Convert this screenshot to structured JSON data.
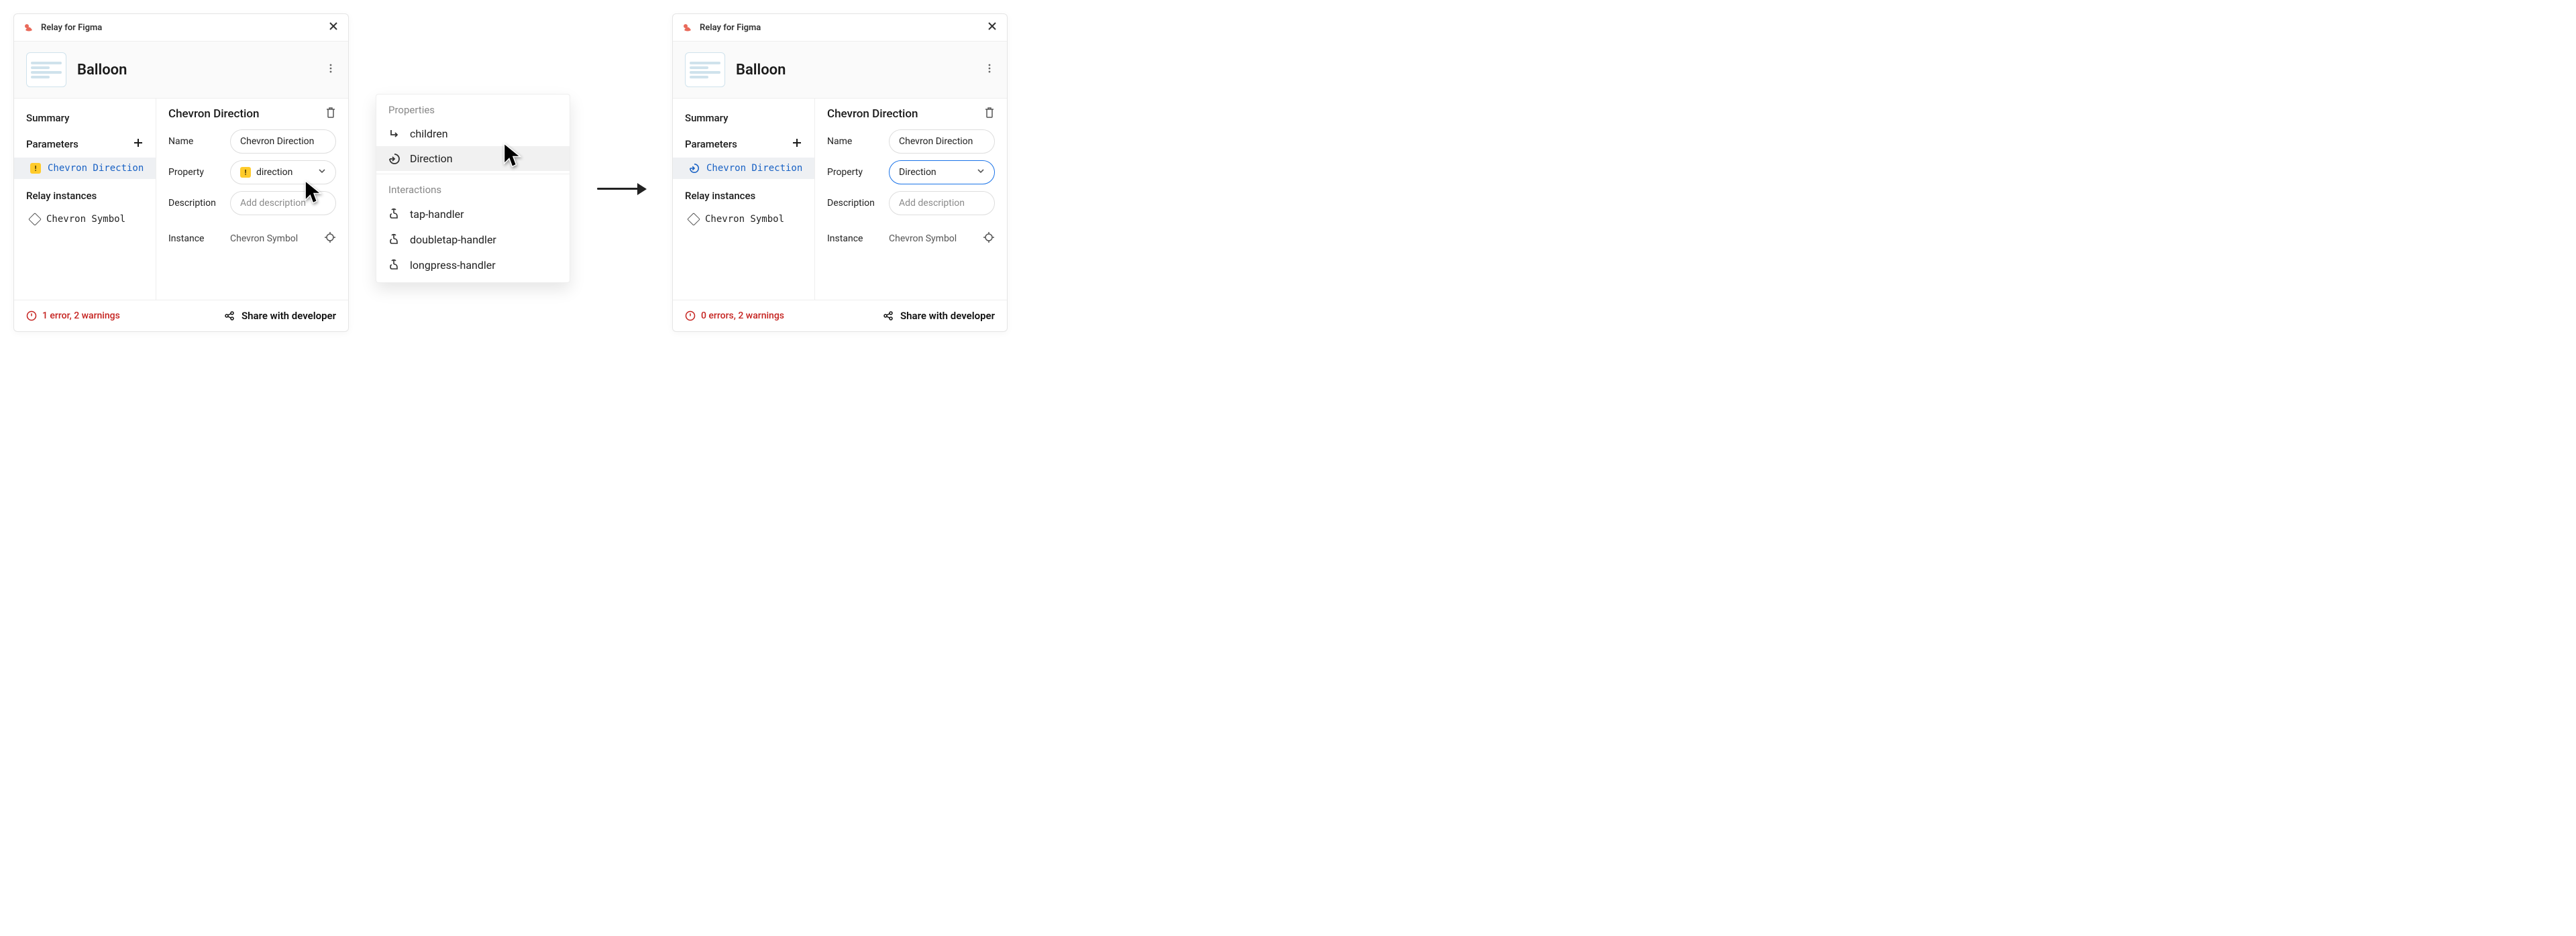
{
  "colors": {
    "accent_blue": "#1861c4",
    "warn_bg": "#ffcb2b",
    "error_red": "#c5221f",
    "brand": "#e96a5b"
  },
  "left": {
    "titlebar": {
      "brand": "Relay for Figma"
    },
    "component_title": "Balloon",
    "sidebar": {
      "summary": "Summary",
      "parameters_label": "Parameters",
      "parameters": [
        {
          "name": "Chevron Direction",
          "warning": true
        }
      ],
      "instances_label": "Relay instances",
      "instances": [
        "Chevron Symbol"
      ]
    },
    "details": {
      "title": "Chevron Direction",
      "rows": {
        "name_label": "Name",
        "name_value": "Chevron Direction",
        "property_label": "Property",
        "property_value": "direction",
        "property_warning": true,
        "description_label": "Description",
        "description_placeholder": "Add description",
        "instance_label": "Instance",
        "instance_value": "Chevron Symbol"
      }
    },
    "footer": {
      "status": "1 error, 2 warnings",
      "share": "Share with developer"
    }
  },
  "popup": {
    "properties_label": "Properties",
    "properties": [
      {
        "icon": "children",
        "label": "children",
        "hover": false
      },
      {
        "icon": "direction",
        "label": "Direction",
        "hover": true
      }
    ],
    "interactions_label": "Interactions",
    "interactions": [
      {
        "icon": "tap",
        "label": "tap-handler"
      },
      {
        "icon": "tap",
        "label": "doubletap-handler"
      },
      {
        "icon": "tap",
        "label": "longpress-handler"
      }
    ]
  },
  "right": {
    "titlebar": {
      "brand": "Relay for Figma"
    },
    "component_title": "Balloon",
    "sidebar": {
      "summary": "Summary",
      "parameters_label": "Parameters",
      "parameters": [
        {
          "name": "Chevron Direction",
          "warning": false
        }
      ],
      "instances_label": "Relay instances",
      "instances": [
        "Chevron Symbol"
      ]
    },
    "details": {
      "title": "Chevron Direction",
      "rows": {
        "name_label": "Name",
        "name_value": "Chevron Direction",
        "property_label": "Property",
        "property_value": "Direction",
        "property_warning": false,
        "property_selected": true,
        "description_label": "Description",
        "description_placeholder": "Add description",
        "instance_label": "Instance",
        "instance_value": "Chevron Symbol"
      }
    },
    "footer": {
      "status": "0 errors, 2 warnings",
      "share": "Share with developer"
    }
  }
}
